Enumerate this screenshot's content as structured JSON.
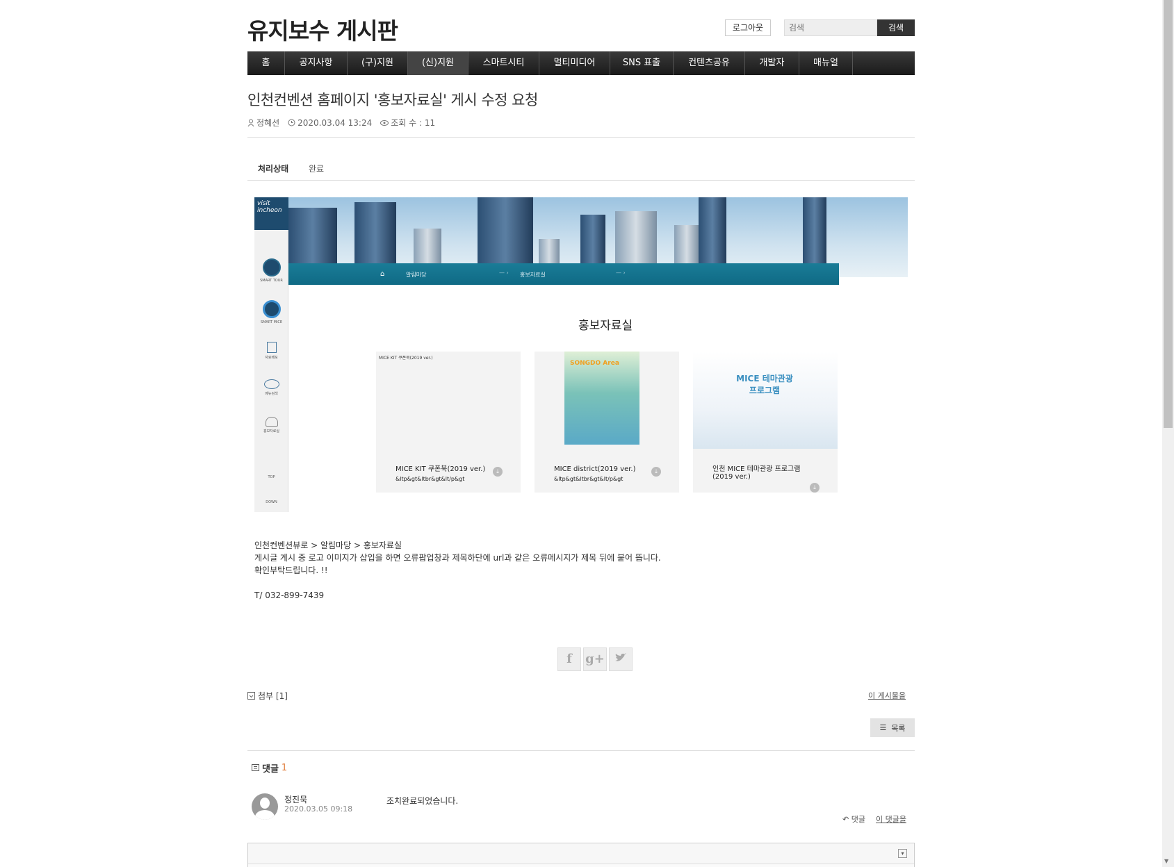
{
  "header": {
    "site_title": "유지보수 게시판",
    "logout_label": "로그아웃",
    "search_placeholder": "검색",
    "search_button": "검색"
  },
  "nav": {
    "items": [
      "홈",
      "공지사항",
      "(구)지원",
      "(신)지원",
      "스마트시티",
      "멀티미디어",
      "SNS 표출",
      "컨텐츠공유",
      "개발자",
      "매뉴얼"
    ],
    "active_index": 3
  },
  "article": {
    "title": "인천컨벤션 홈페이지 '홍보자료실' 게시 수정 요청",
    "author": "정혜선",
    "datetime": "2020.03.04 13:24",
    "views_label": "조회 수 : 11",
    "status_label": "처리상태",
    "status_value": "완료"
  },
  "embedded_screenshot": {
    "logo_text": "visit incheon",
    "side_items": [
      "SMART TOUR",
      "SMART MICE",
      "자료배포",
      "메뉴검색",
      "홍보자료실",
      "TOP",
      "DOWN"
    ],
    "breadcrumb_1": "알림마당",
    "breadcrumb_2": "홍보자료실",
    "heading": "홍보자료실",
    "cards": [
      {
        "small_label": "MICE KIT 쿠폰북(2019 ver.)",
        "title": "MICE KIT 쿠폰북(2019 ver.)",
        "sub": "&ltp&gt&ltbr&gt&lt/p&gt"
      },
      {
        "title": "MICE district(2019 ver.)",
        "sub": "&ltp&gt&ltbr&gt&lt/p&gt",
        "img_text": "SONGDO Area"
      },
      {
        "title": "인천 MICE 테마관광 프로그램",
        "title2": "(2019 ver.)",
        "img_text": "MICE 테마관광 프로그램"
      }
    ]
  },
  "body": {
    "line1": "인천컨벤션뷰로 > 알림마당 > 홍보자료실",
    "line2": "게시글 게시 중 로고 이미지가 삽입을 하면 오류팝업창과 제목하단에 url과 같은 오류메시지가 제목 뒤에 붙어 뜹니다.",
    "line3": "확인부탁드립니다. !!",
    "line4": "T/ 032-899-7439"
  },
  "share": {
    "facebook": "f",
    "google": "g+",
    "twitter": "t"
  },
  "attachment_label": "첨부 [1]",
  "this_post_label": "이 게시물을",
  "list_button": "목록",
  "comments": {
    "header": "댓글",
    "count": "1",
    "items": [
      {
        "author": "정진묵",
        "date": "2020.03.05 09:18",
        "text": "조치완료되었습니다.",
        "reply_label": "댓글",
        "this_comment_label": "이 댓글을"
      }
    ]
  }
}
